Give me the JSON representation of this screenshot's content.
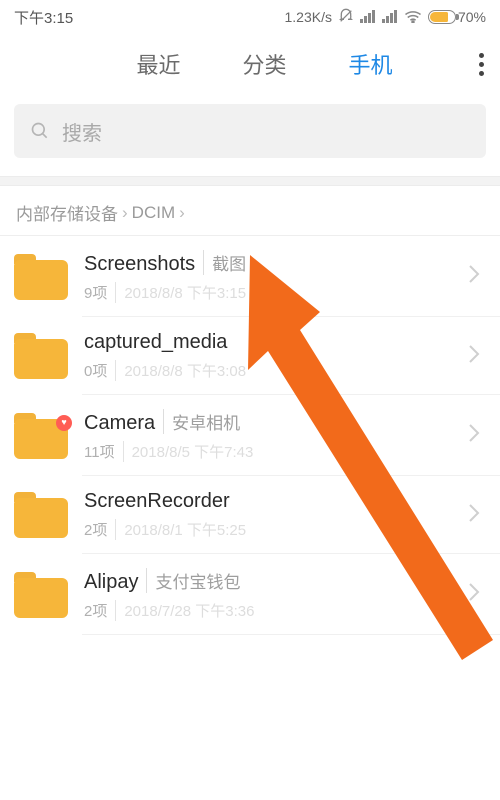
{
  "status": {
    "time": "下午3:15",
    "net_speed": "1.23K/s",
    "battery_pct": "70%"
  },
  "tabs": {
    "recent": "最近",
    "category": "分类",
    "phone": "手机"
  },
  "search": {
    "placeholder": "搜索"
  },
  "breadcrumb": {
    "root": "内部存储设备",
    "segment": "DCIM"
  },
  "folders": [
    {
      "name": "Screenshots",
      "alias": "截图",
      "count": "9项",
      "date": "2018/8/8 下午3:15",
      "badge": false
    },
    {
      "name": "captured_media",
      "alias": "",
      "count": "0项",
      "date": "2018/8/8 下午3:08",
      "badge": false
    },
    {
      "name": "Camera",
      "alias": "安卓相机",
      "count": "11项",
      "date": "2018/8/5 下午7:43",
      "badge": true
    },
    {
      "name": "ScreenRecorder",
      "alias": "",
      "count": "2项",
      "date": "2018/8/1 下午5:25",
      "badge": false
    },
    {
      "name": "Alipay",
      "alias": "支付宝钱包",
      "count": "2项",
      "date": "2018/7/28 下午3:36",
      "badge": false
    }
  ],
  "colors": {
    "accent": "#1e88e5",
    "folder": "#f6b63a",
    "arrow": "#f26a1b"
  }
}
